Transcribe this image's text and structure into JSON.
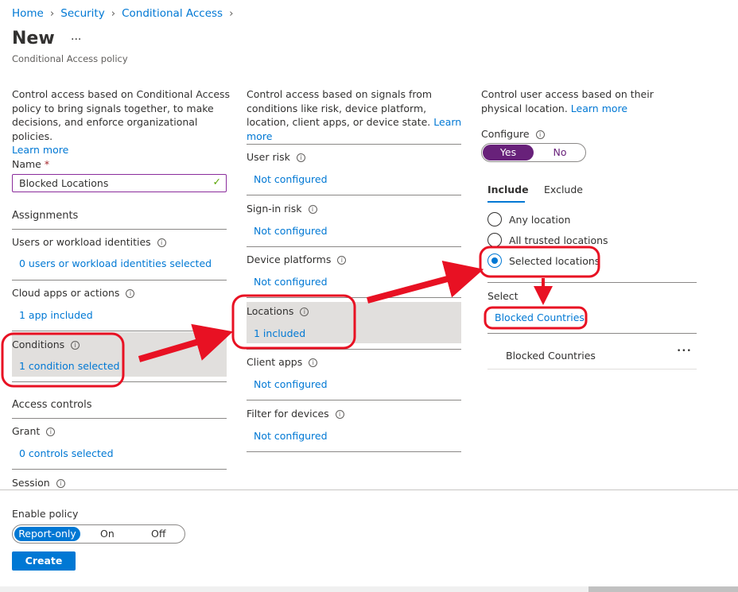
{
  "breadcrumb": [
    "Home",
    "Security",
    "Conditional Access"
  ],
  "title": "New",
  "more": "...",
  "subtitle": "Conditional Access policy",
  "col1": {
    "desc": "Control access based on Conditional Access policy to bring signals together, to make decisions, and enforce organizational policies.",
    "learn_more": "Learn more",
    "name_label": "Name",
    "required": "*",
    "name_value": "Blocked Locations",
    "assignments": "Assignments",
    "users_label": "Users or workload identities",
    "users_value": "0 users or workload identities selected",
    "apps_label": "Cloud apps or actions",
    "apps_value": "1 app included",
    "conditions_label": "Conditions",
    "conditions_value": "1 condition selected",
    "access_controls": "Access controls",
    "grant_label": "Grant",
    "grant_value": "0 controls selected",
    "session_label": "Session"
  },
  "col2": {
    "desc": "Control access based on signals from conditions like risk, device platform, location, client apps, or device state.",
    "learn_more": "Learn more",
    "items": [
      {
        "label": "User risk",
        "value": "Not configured"
      },
      {
        "label": "Sign-in risk",
        "value": "Not configured"
      },
      {
        "label": "Device platforms",
        "value": "Not configured"
      },
      {
        "label": "Locations",
        "value": "1 included"
      },
      {
        "label": "Client apps",
        "value": "Not configured"
      },
      {
        "label": "Filter for devices",
        "value": "Not configured"
      }
    ]
  },
  "col3": {
    "desc": "Control user access based on their physical location.",
    "learn_more": "Learn more",
    "configure": "Configure",
    "yes": "Yes",
    "no": "No",
    "tab_include": "Include",
    "tab_exclude": "Exclude",
    "radios": [
      "Any location",
      "All trusted locations",
      "Selected locations"
    ],
    "selected_radio": 2,
    "select_label": "Select",
    "select_link": "Blocked Countries",
    "row_name": "Blocked Countries",
    "row_more": "•••"
  },
  "footer": {
    "enable_policy": "Enable policy",
    "options": [
      "Report-only",
      "On",
      "Off"
    ],
    "selected": "Report-only",
    "create": "Create"
  },
  "colors": {
    "link": "#0078d4",
    "purple": "#68217a",
    "annotation": "#e81123"
  }
}
